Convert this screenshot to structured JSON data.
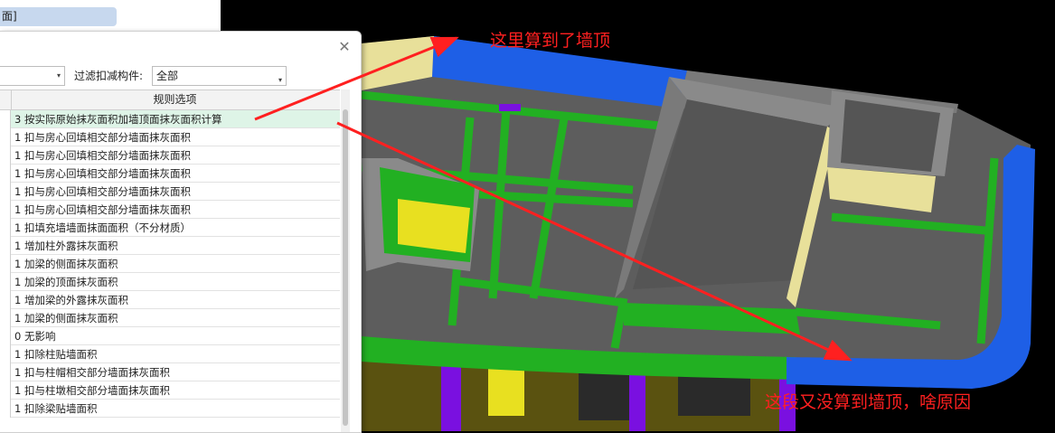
{
  "background_panel": {
    "tab_label": "面]"
  },
  "dialog": {
    "close_glyph": "✕",
    "filter_label": "过滤扣减构件:",
    "filter_value": "全部",
    "combo_arrow": "▾",
    "table_header": "规则选项",
    "rows": [
      "3 按实际原始抹灰面积加墙顶面抹灰面积计算",
      "1 扣与房心回填相交部分墙面抹灰面积",
      "1 扣与房心回填相交部分墙面抹灰面积",
      "1 扣与房心回填相交部分墙面抹灰面积",
      "1 扣与房心回填相交部分墙面抹灰面积",
      "1 扣与房心回填相交部分墙面抹灰面积",
      "1 扣填充墙墙面抹面面积（不分材质）",
      "1 增加柱外露抹灰面积",
      "1 加梁的侧面抹灰面积",
      "1 加梁的顶面抹灰面积",
      "1 增加梁的外露抹灰面积",
      "1 加梁的侧面抹灰面积",
      "0  无影响",
      "1 扣除柱贴墙面积",
      "1 扣与柱帽相交部分墙面抹灰面积",
      "1 扣与柱墩相交部分墙面抹灰面积",
      "1 扣除梁贴墙面积"
    ],
    "selected_row_index": 0
  },
  "annotations": {
    "top_text": "这里算到了墙顶",
    "bottom_text": "这段又没算到墙顶，啥原因"
  },
  "colors": {
    "annotation_red": "#ff2020",
    "selected_row": "#def4e7",
    "wall_top_blue": "#1e5fe6",
    "slab_gray": "#606060",
    "beam_green": "#22b022",
    "column_purple": "#7a10e0",
    "wall_yellow": "#e8e09a"
  }
}
